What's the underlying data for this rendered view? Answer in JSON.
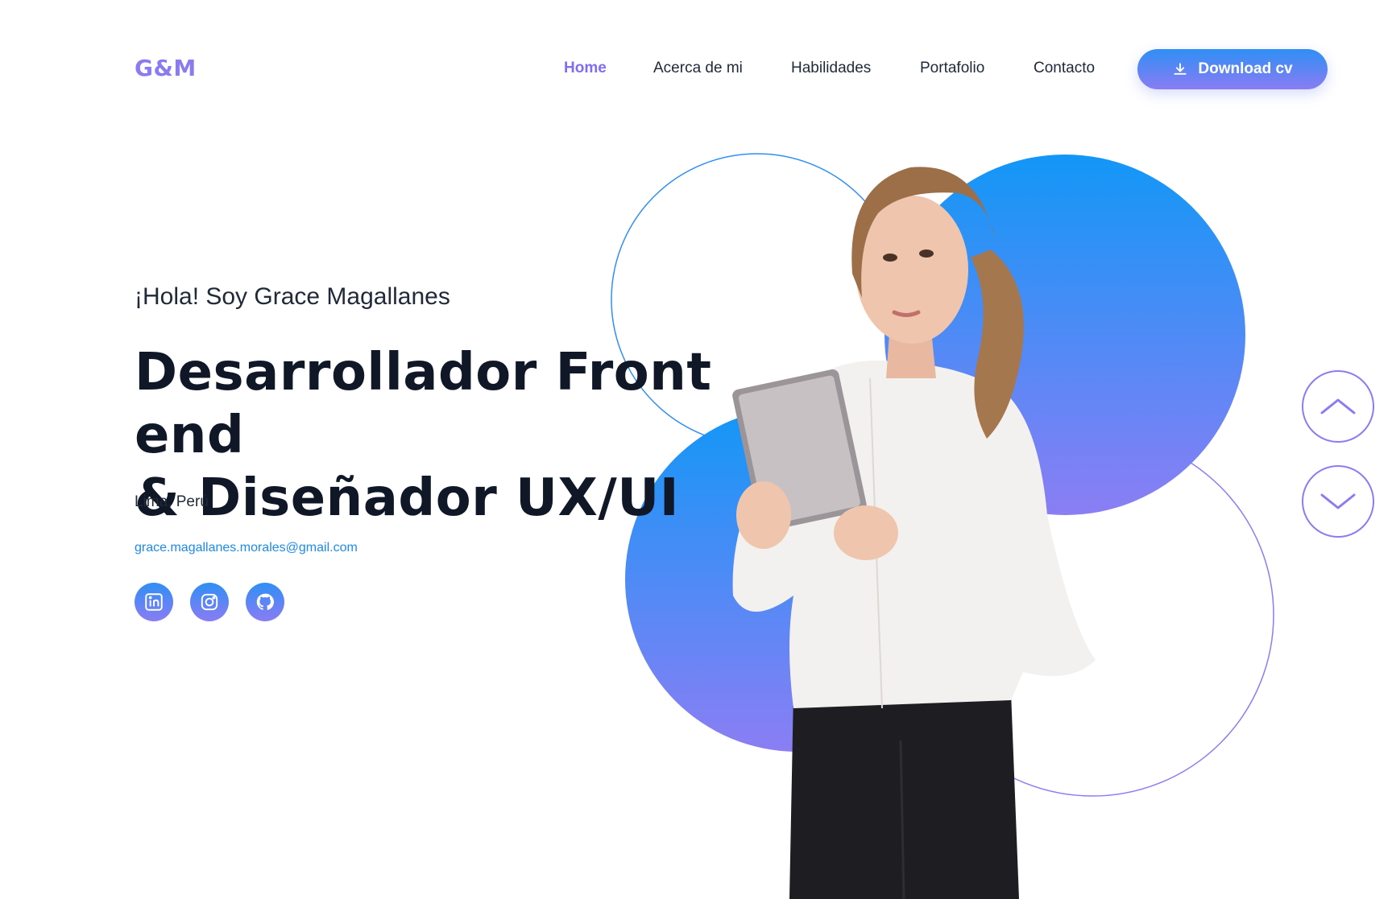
{
  "brand": {
    "logo": "G&M"
  },
  "nav": {
    "items": [
      {
        "label": "Home",
        "active": true
      },
      {
        "label": "Acerca de mi",
        "active": false
      },
      {
        "label": "Habilidades",
        "active": false
      },
      {
        "label": "Portafolio",
        "active": false
      },
      {
        "label": "Contacto",
        "active": false
      }
    ],
    "cta_label": "Download cv",
    "cta_icon": "download-icon"
  },
  "hero": {
    "greeting": "¡Hola! Soy Grace Magallanes",
    "title_line1": "Desarrollador Front end",
    "title_line2": "& Diseñador UX/UI",
    "location": "Lima, Perú",
    "email": "grace.magallanes.morales@gmail.com",
    "socials": [
      {
        "name": "linkedin-icon"
      },
      {
        "name": "instagram-icon"
      },
      {
        "name": "github-icon"
      }
    ]
  },
  "scroll_controls": {
    "up_icon": "chevron-up-icon",
    "down_icon": "chevron-down-icon"
  },
  "colors": {
    "accent": "#7f6df2",
    "gradient_start": "#2f8ff5",
    "gradient_end": "#8a7cf3",
    "text_dark": "#101828",
    "link": "#1d8be8"
  }
}
